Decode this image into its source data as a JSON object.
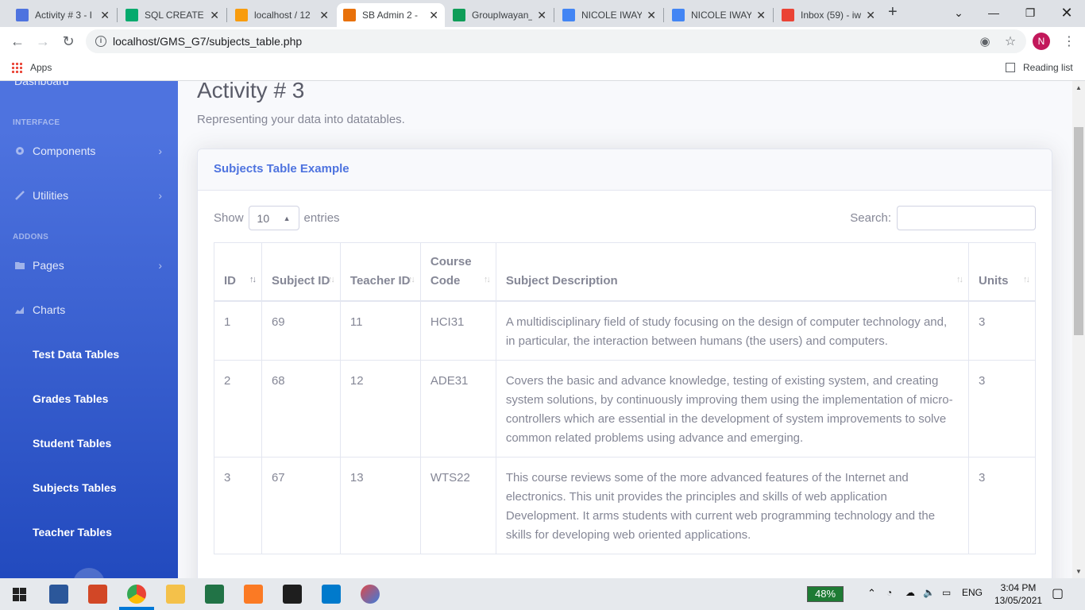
{
  "browser": {
    "tabs": [
      {
        "title": "Activity # 3 - I",
        "color": "#4e73df"
      },
      {
        "title": "SQL CREATE T",
        "color": "#04aa6d"
      },
      {
        "title": "localhost / 12",
        "color": "#f89c0e"
      },
      {
        "title": "SB Admin 2 -",
        "color": "#e8710a"
      },
      {
        "title": "GroupIwayan_",
        "color": "#0f9d58"
      },
      {
        "title": "NICOLE IWAY",
        "color": "#4285f4"
      },
      {
        "title": "NICOLE IWAY",
        "color": "#4285f4"
      },
      {
        "title": "Inbox (59) - iw",
        "color": "#ea4335"
      }
    ],
    "url": "localhost/GMS_G7/subjects_table.php",
    "profile_initial": "N",
    "bookmarks_apps": "Apps",
    "reading_list": "Reading list"
  },
  "sidebar": {
    "dashboard": "Dashboard",
    "heading_interface": "INTERFACE",
    "heading_addons": "ADDONS",
    "components": "Components",
    "utilities": "Utilities",
    "pages": "Pages",
    "charts": "Charts",
    "sub_items": [
      "Test Data Tables",
      "Grades Tables",
      "Student Tables",
      "Subjects Tables",
      "Teacher Tables"
    ]
  },
  "page": {
    "title": "Activity # 3",
    "subtitle": "Representing your data into datatables.",
    "card_title": "Subjects Table Example",
    "show_label": "Show",
    "entries_value": "10",
    "entries_label": "entries",
    "search_label": "Search:"
  },
  "table": {
    "headers": [
      "ID",
      "Subject ID",
      "Teacher ID",
      "Course Code",
      "Subject Description",
      "Units"
    ],
    "rows": [
      [
        "1",
        "69",
        "11",
        "HCI31",
        "A multidisciplinary field of study focusing on the design of computer technology and, in particular, the interaction between humans (the users) and computers.",
        "3"
      ],
      [
        "2",
        "68",
        "12",
        "ADE31",
        "Covers the basic and advance knowledge, testing of existing system, and creating system solutions, by continuously improving them using the implementation of micro-controllers which are essential in the development of system improvements to solve common related problems using advance and emerging.",
        "3"
      ],
      [
        "3",
        "67",
        "13",
        "WTS22",
        "This course reviews some of the more advanced features of the Internet and electronics. This unit provides the principles and skills of web application Development. It arms students with current web programming technology and the skills for developing web oriented applications.",
        "3"
      ]
    ]
  },
  "taskbar": {
    "battery": "48%",
    "lang": "ENG",
    "time": "3:04 PM",
    "date": "13/05/2021"
  }
}
